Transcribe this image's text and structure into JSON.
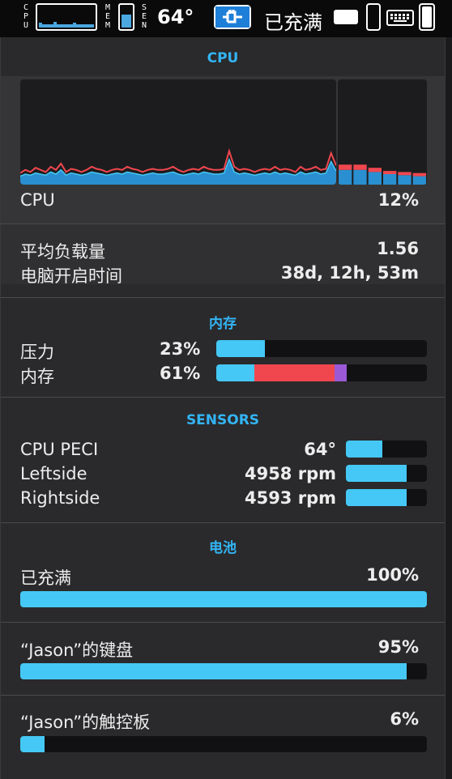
{
  "menubar": {
    "cpu_label": "CPU",
    "mem_label": "MEM",
    "sen_label": "SEN",
    "temperature": "64°",
    "battery_status": "已充满",
    "mem_level": 0.61,
    "battery_level": 1.0,
    "keyboard_level": 0.95,
    "trackpad_level": 0.06,
    "icons": [
      "cpu-graph-icon",
      "memory-gauge-icon",
      "power-plug-icon",
      "battery-icon",
      "keyboard-icon",
      "trackpad-battery-icon"
    ]
  },
  "cpu": {
    "title": "CPU",
    "label": "CPU",
    "value": "12%",
    "load_label": "平均负载量",
    "load_value": "1.56",
    "uptime_label": "电脑开启时间",
    "uptime_value": "38d, 12h, 53m",
    "history_user": [
      8,
      10,
      9,
      11,
      10,
      9,
      12,
      10,
      14,
      9,
      11,
      10,
      9,
      10,
      12,
      11,
      10,
      9,
      10,
      11,
      10,
      12,
      11,
      10,
      9,
      10,
      11,
      10,
      10,
      11,
      12,
      10,
      9,
      10,
      11,
      10,
      12,
      11,
      10,
      10,
      11,
      24,
      12,
      10,
      11,
      10,
      9,
      10,
      11,
      10,
      12,
      10,
      11,
      10,
      9,
      12,
      10,
      11,
      12,
      10,
      11,
      22,
      13
    ],
    "history_system": [
      3,
      4,
      3,
      5,
      4,
      3,
      5,
      4,
      6,
      3,
      4,
      4,
      3,
      4,
      5,
      4,
      4,
      3,
      4,
      4,
      4,
      5,
      4,
      4,
      3,
      4,
      4,
      4,
      4,
      4,
      5,
      4,
      3,
      4,
      4,
      4,
      5,
      4,
      4,
      4,
      4,
      8,
      5,
      4,
      4,
      4,
      3,
      4,
      4,
      4,
      5,
      4,
      4,
      4,
      3,
      5,
      4,
      4,
      5,
      4,
      4,
      8,
      5
    ],
    "core_user": [
      14,
      14,
      12,
      10,
      9,
      8
    ],
    "core_system": [
      5,
      5,
      4,
      3,
      3,
      3
    ]
  },
  "memory": {
    "title": "内存",
    "pressure_label": "压力",
    "pressure_value": "23%",
    "pressure_level": 0.23,
    "usage_label": "内存",
    "usage_value": "61%",
    "segments": [
      {
        "name": "app",
        "color": "#45c8f5",
        "fraction": 0.18
      },
      {
        "name": "wired",
        "color": "#f0474f",
        "fraction": 0.38
      },
      {
        "name": "compressed",
        "color": "#9b59d6",
        "fraction": 0.06
      }
    ]
  },
  "sensors": {
    "title": "SENSORS",
    "rows": [
      {
        "label": "CPU PECI",
        "value": "64°",
        "level": 0.45
      },
      {
        "label": "Leftside",
        "value": "4958 rpm",
        "level": 0.75
      },
      {
        "label": "Rightside",
        "value": "4593 rpm",
        "level": 0.75
      }
    ]
  },
  "battery": {
    "title": "电池",
    "status_label": "已充满",
    "status_value": "100%",
    "status_level": 1.0,
    "keyboard_label": "“Jason”的键盘",
    "keyboard_value": "95%",
    "keyboard_level": 0.95,
    "trackpad_label": "“Jason”的触控板",
    "trackpad_value": "6%",
    "trackpad_level": 0.06
  },
  "colors": {
    "accent": "#33b5f5",
    "bar_fill": "#45c8f5",
    "red": "#f0474f",
    "purple": "#9b59d6",
    "panel": "#2a2a2c"
  }
}
